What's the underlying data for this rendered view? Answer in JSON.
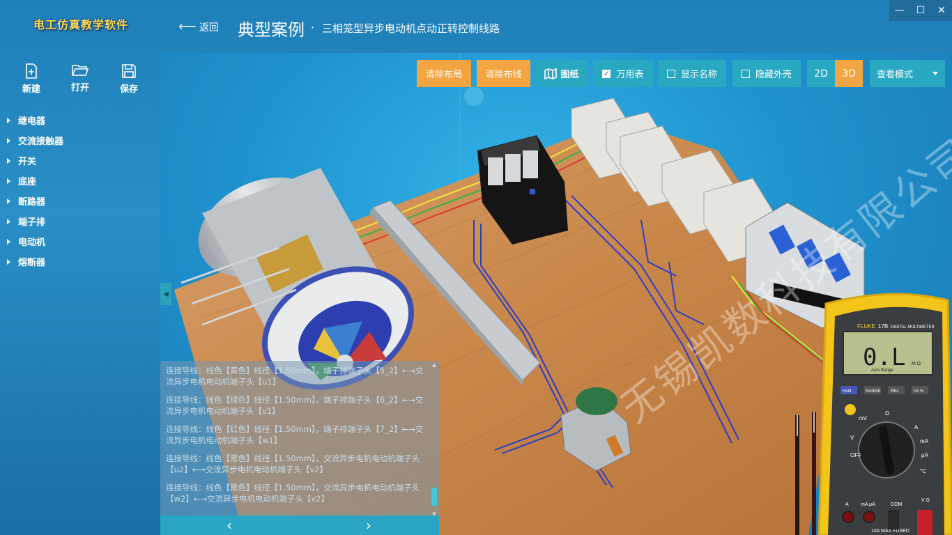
{
  "app": {
    "logo_text": "电工仿真教学软件"
  },
  "header": {
    "back_label": "返回",
    "title": "典型案例",
    "separator": "·",
    "subtitle": "三相笼型异步电动机点动正转控制线路"
  },
  "window_controls": {
    "minimize": "—",
    "maximize": "☐",
    "close": "✕"
  },
  "file_actions": {
    "new_label": "新建",
    "open_label": "打开",
    "save_label": "保存"
  },
  "categories": [
    "继电器",
    "交流接触器",
    "开关",
    "底座",
    "断路器",
    "端子排",
    "电动机",
    "熔断器"
  ],
  "toolbar": {
    "clear_layout": "清除布局",
    "clear_wires": "清除布线",
    "drawing": "图纸",
    "multimeter": {
      "label": "万用表",
      "checked": true
    },
    "show_names": {
      "label": "显示名称",
      "checked": false
    },
    "hide_shell": {
      "label": "隐藏外壳",
      "checked": false
    },
    "mode_2d": "2D",
    "mode_3d": "3D",
    "active_mode": "3D",
    "view_mode": "查看模式"
  },
  "log": {
    "entries": [
      "连接导线：线色【黄色】线径【1.50mm】，端子排端子头【5_2】←→交流异步电机电动机端子头【u1】",
      "连接导线：线色【绿色】线径【1.50mm】，端子排端子头【6_2】←→交流异步电机电动机端子头【v1】",
      "连接导线：线色【红色】线径【1.50mm】，端子排端子头【7_2】←→交流异步电机电动机端子头【w1】",
      "连接导线：线色【黑色】线径【1.50mm】，交流异步电机电动机端子头【u2】←→交流异步电机电动机端子头【v2】",
      "连接导线：线色【黑色】线径【1.50mm】，交流异步电机电动机端子头【w2】←→交流异步电机电动机端子头【v2】"
    ],
    "prev": "‹",
    "next": "›"
  },
  "multimeter": {
    "brand": "FLUKE",
    "model": "17B",
    "model_caption": "DIGITAL MULTIMETER",
    "reading": "0.L",
    "unit": "M Ω",
    "range_caption": "Auto Range",
    "buttons": [
      "Hold",
      "RANGE",
      "REL",
      "Hz %"
    ],
    "dial_labels": [
      "mV",
      "Ω",
      "A",
      "mA",
      "μA",
      "V",
      "OFF",
      "°C"
    ],
    "jacks": [
      "A",
      "mA μA",
      "COM",
      "V Ω"
    ],
    "jack_note": "10A MAX FUSED"
  },
  "watermark": "无锡凯数科技有限公司",
  "colors": {
    "background": "#2189c1",
    "toolbar_orange": "#f2a540",
    "toolbar_teal": "#29a8c2",
    "logo_yellow": "#ffd84a",
    "board_wood": "#c9874a",
    "meter_yellow": "#f3c51b"
  },
  "icons": {
    "new": "file-plus-icon",
    "open": "folder-open-icon",
    "save": "floppy-disk-icon",
    "drawing": "map-icon",
    "back": "arrow-left-icon"
  }
}
